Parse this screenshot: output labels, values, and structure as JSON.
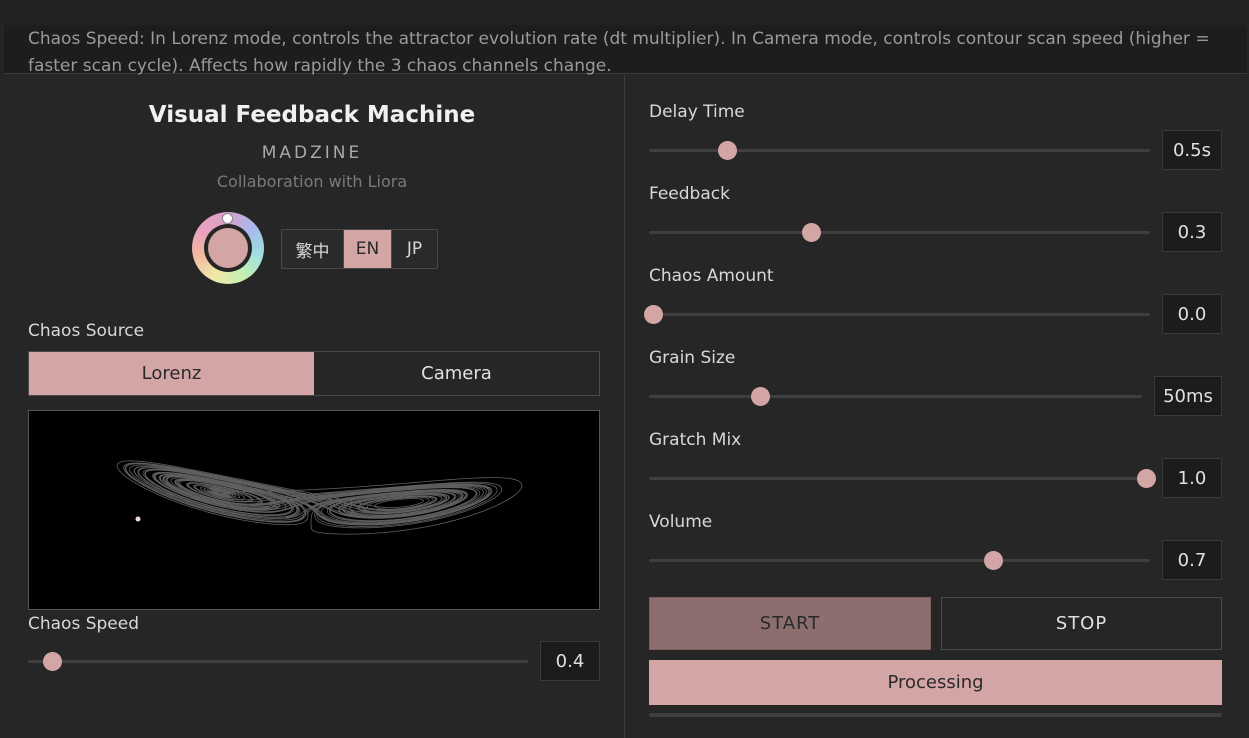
{
  "tooltip": {
    "line1": "Chaos Speed: In Lorenz mode, controls the attractor evolution rate (dt multiplier). In Camera mode, controls contour scan speed (higher =",
    "line2": "faster scan cycle). Affects how rapidly the 3 chaos channels change."
  },
  "header": {
    "title": "Visual Feedback Machine",
    "brand": "MADZINE",
    "subtitle": "Collaboration with Liora"
  },
  "languages": [
    {
      "label": "繁中",
      "active": false
    },
    {
      "label": "EN",
      "active": true
    },
    {
      "label": "JP",
      "active": false
    }
  ],
  "chaos_source": {
    "label": "Chaos Source",
    "options": [
      {
        "label": "Lorenz",
        "active": true
      },
      {
        "label": "Camera",
        "active": false
      }
    ]
  },
  "chaos_speed": {
    "label": "Chaos Speed",
    "value": "0.4",
    "level": 0.04
  },
  "params": [
    {
      "label": "Delay Time",
      "value": "0.5s",
      "level": 0.15
    },
    {
      "label": "Feedback",
      "value": "0.3",
      "level": 0.32
    },
    {
      "label": "Chaos Amount",
      "value": "0.0",
      "level": 0.0
    },
    {
      "label": "Grain Size",
      "value": "50ms",
      "level": 0.22
    },
    {
      "label": "Gratch Mix",
      "value": "1.0",
      "level": 1.0
    },
    {
      "label": "Volume",
      "value": "0.7",
      "level": 0.69
    }
  ],
  "controls": {
    "start_label": "START",
    "stop_label": "STOP",
    "status_label": "Processing"
  },
  "colors": {
    "accent": "#d4a5a5",
    "background": "#262626",
    "start_active": "#8c6e6e"
  }
}
